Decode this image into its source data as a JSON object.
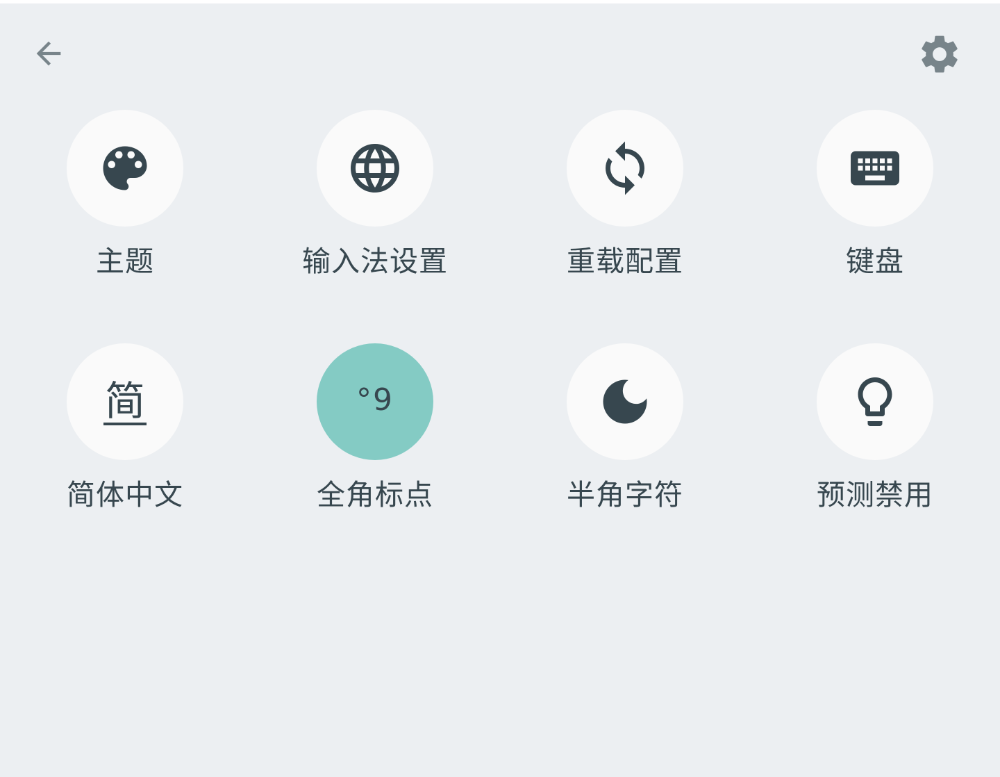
{
  "topbar": {
    "back_icon": "arrow-back-icon",
    "settings_icon": "gear-icon"
  },
  "colors": {
    "background": "#eceff2",
    "circle": "#fafafa",
    "active_circle": "#84cbc4",
    "icon": "#37474f",
    "toolbar_icon": "#78848a"
  },
  "items": [
    {
      "label": "主题",
      "icon": "palette-icon",
      "active": false
    },
    {
      "label": "输入法设置",
      "icon": "globe-icon",
      "active": false
    },
    {
      "label": "重载配置",
      "icon": "sync-icon",
      "active": false
    },
    {
      "label": "键盘",
      "icon": "keyboard-icon",
      "active": false
    },
    {
      "label": "简体中文",
      "icon": "simplified-chinese-icon",
      "glyph": "简",
      "active": false
    },
    {
      "label": "全角标点",
      "icon": "full-width-punctuation-icon",
      "glyph": "°9",
      "active": true
    },
    {
      "label": "半角字符",
      "icon": "moon-icon",
      "active": false
    },
    {
      "label": "预测禁用",
      "icon": "lightbulb-icon",
      "active": false
    }
  ]
}
